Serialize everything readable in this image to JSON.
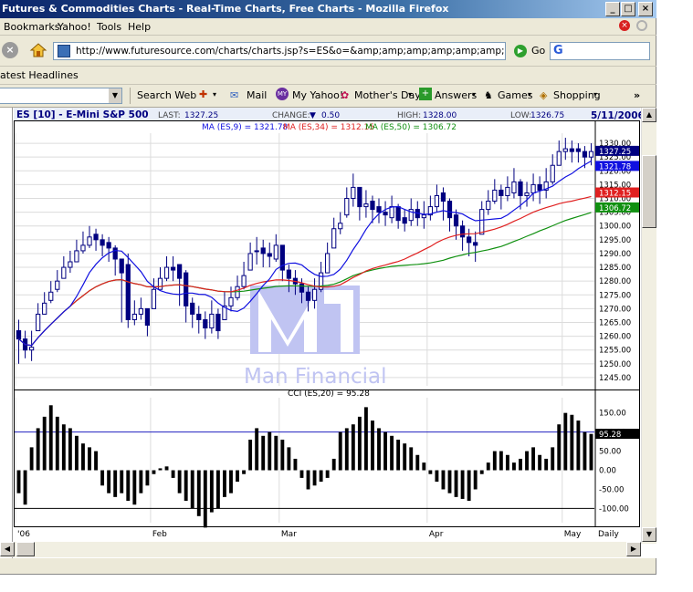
{
  "window": {
    "title": "Futures & Commodities Charts - Real-Time Charts, Free Charts - Mozilla Firefox"
  },
  "menu": [
    "Bookmarks",
    "Yahoo!",
    "Tools",
    "Help"
  ],
  "nav": {
    "url": "http://www.futuresource.com/charts/charts.jsp?s=ES&o=&amp;amp;amp;amp;amp;amp;amp;amp;amp;a=D&",
    "go_label": "Go",
    "search_logo": "G"
  },
  "bookmarks": {
    "headlines_label": "atest Headlines"
  },
  "yahoo_toolbar": {
    "items": [
      "Search Web",
      "Mail",
      "My Yahoo!",
      "Mother's Day",
      "Answers",
      "Games",
      "Shopping"
    ],
    "overflow": "»"
  },
  "chart_header": {
    "symbol": "ES [10] - E-Mini S&P 500",
    "last_label": "LAST:",
    "last_value": "1327.25",
    "change_label": "CHANGE:",
    "change_value": "0.50",
    "high_label": "HIGH:",
    "high_value": "1328.00",
    "low_label": "LOW:",
    "low_value": "1326.75",
    "date": "5/11/2006",
    "ma9_label": "MA (ES,9) = 1321.78",
    "ma34_label": "MA (ES,34) = 1312.15",
    "ma50_label": "MA (ES,50) = 1306.72",
    "cci_label": "CCI (ES,20) = 95.28",
    "watermark": "Man Financial",
    "period_label": "Daily",
    "colors": {
      "ma9": "#1010e0",
      "ma34": "#e02020",
      "ma50": "#109010",
      "candles": "#000080",
      "header_text": "#000080",
      "watermark": "#c0c4f2"
    }
  },
  "chart_data": [
    {
      "type": "candlestick",
      "title": "ES [10] - E-Mini S&P 500",
      "period": "Daily",
      "ylim": [
        1242,
        1333
      ],
      "y_ticks": [
        "1330.00",
        "1325.00",
        "1320.00",
        "1315.00",
        "1310.00",
        "1305.00",
        "1300.00",
        "1295.00",
        "1290.00",
        "1285.00",
        "1280.00",
        "1275.00",
        "1270.00",
        "1265.00",
        "1260.00",
        "1255.00",
        "1250.00",
        "1245.00"
      ],
      "y_tick_values": [
        1330,
        1325,
        1320,
        1315,
        1310,
        1305,
        1300,
        1295,
        1290,
        1285,
        1280,
        1275,
        1270,
        1265,
        1260,
        1255,
        1250,
        1245
      ],
      "x_ticks": [
        "'06",
        "Feb",
        "Mar",
        "Apr",
        "May"
      ],
      "x_tick_index": [
        0,
        21,
        41,
        64,
        85
      ],
      "price_tags": [
        {
          "label": "1327.25",
          "value": 1327.25,
          "color": "#000080"
        },
        {
          "label": "1321.78",
          "value": 1321.78,
          "color": "#1010e0"
        },
        {
          "label": "1312.15",
          "value": 1312.15,
          "color": "#e02020"
        },
        {
          "label": "1306.72",
          "value": 1306.72,
          "color": "#109010"
        }
      ],
      "series": [
        {
          "name": "ES",
          "close": [
            1259,
            1255,
            1256,
            1268,
            1272,
            1276,
            1280,
            1285,
            1287,
            1291,
            1293,
            1296,
            1295,
            1293,
            1292,
            1288,
            1283,
            1266,
            1268,
            1270,
            1264,
            1277,
            1281,
            1285,
            1284,
            1281,
            1271,
            1268,
            1266,
            1263,
            1268,
            1262,
            1271,
            1274,
            1278,
            1282,
            1290,
            1291,
            1290,
            1289,
            1293,
            1284,
            1281,
            1279,
            1276,
            1273,
            1277,
            1283,
            1290,
            1299,
            1301,
            1310,
            1314,
            1307,
            1308,
            1306,
            1305,
            1304,
            1307,
            1302,
            1301,
            1306,
            1303,
            1304,
            1307,
            1311,
            1309,
            1303,
            1300,
            1296,
            1294,
            1293,
            1306,
            1309,
            1313,
            1311,
            1314,
            1316,
            1311,
            1312,
            1315,
            1313,
            1316,
            1322,
            1327,
            1328,
            1327,
            1327,
            1325,
            1327
          ],
          "high": [
            1266,
            1262,
            1262,
            1272,
            1276,
            1280,
            1284,
            1289,
            1291,
            1295,
            1298,
            1300,
            1299,
            1297,
            1296,
            1293,
            1288,
            1290,
            1273,
            1274,
            1270,
            1281,
            1285,
            1289,
            1289,
            1286,
            1284,
            1274,
            1271,
            1269,
            1273,
            1270,
            1276,
            1278,
            1282,
            1287,
            1294,
            1296,
            1295,
            1294,
            1297,
            1292,
            1286,
            1284,
            1281,
            1278,
            1281,
            1287,
            1294,
            1303,
            1305,
            1314,
            1319,
            1313,
            1313,
            1311,
            1310,
            1309,
            1311,
            1308,
            1306,
            1310,
            1309,
            1309,
            1311,
            1315,
            1314,
            1310,
            1306,
            1302,
            1299,
            1298,
            1309,
            1313,
            1317,
            1315,
            1318,
            1321,
            1317,
            1316,
            1319,
            1318,
            1321,
            1326,
            1331,
            1332,
            1331,
            1330,
            1329,
            1330
          ],
          "low": [
            1250,
            1252,
            1251,
            1262,
            1268,
            1272,
            1276,
            1281,
            1283,
            1287,
            1290,
            1292,
            1291,
            1289,
            1287,
            1282,
            1265,
            1263,
            1264,
            1266,
            1260,
            1270,
            1277,
            1280,
            1280,
            1271,
            1265,
            1263,
            1261,
            1259,
            1261,
            1259,
            1266,
            1269,
            1273,
            1277,
            1284,
            1286,
            1285,
            1285,
            1287,
            1280,
            1276,
            1275,
            1272,
            1269,
            1270,
            1276,
            1283,
            1292,
            1297,
            1303,
            1307,
            1302,
            1303,
            1301,
            1301,
            1300,
            1301,
            1299,
            1298,
            1300,
            1300,
            1299,
            1302,
            1305,
            1302,
            1298,
            1295,
            1291,
            1289,
            1287,
            1297,
            1304,
            1308,
            1306,
            1309,
            1310,
            1306,
            1307,
            1309,
            1308,
            1310,
            1315,
            1322,
            1324,
            1323,
            1323,
            1321,
            1322
          ],
          "open": [
            1262,
            1259,
            1255,
            1262,
            1268,
            1273,
            1277,
            1281,
            1285,
            1287,
            1291,
            1293,
            1297,
            1295,
            1294,
            1292,
            1288,
            1286,
            1266,
            1268,
            1270,
            1270,
            1277,
            1281,
            1285,
            1286,
            1283,
            1272,
            1268,
            1266,
            1263,
            1268,
            1266,
            1271,
            1274,
            1278,
            1284,
            1291,
            1292,
            1290,
            1288,
            1293,
            1284,
            1281,
            1279,
            1276,
            1273,
            1277,
            1283,
            1292,
            1299,
            1304,
            1310,
            1314,
            1307,
            1309,
            1307,
            1305,
            1303,
            1307,
            1303,
            1302,
            1306,
            1303,
            1304,
            1307,
            1312,
            1309,
            1304,
            1300,
            1296,
            1294,
            1297,
            1306,
            1309,
            1313,
            1311,
            1312,
            1316,
            1311,
            1312,
            1315,
            1313,
            1316,
            1322,
            1327,
            1328,
            1328,
            1327,
            1325
          ]
        }
      ]
    },
    {
      "type": "bar",
      "title": "CCI (ES,20) = 95.28",
      "ylim": [
        -130,
        185
      ],
      "y_ticks": [
        "150.00",
        "100.00",
        "50.00",
        "0.00",
        "-50.00",
        "-100.00"
      ],
      "y_tick_values": [
        150,
        100,
        50,
        0,
        -50,
        -100
      ],
      "reference_lines": [
        100,
        -100
      ],
      "current_label": "95.28",
      "current_value": 95.28,
      "values": [
        -60,
        -90,
        60,
        110,
        140,
        170,
        140,
        120,
        110,
        90,
        70,
        60,
        50,
        -40,
        -60,
        -70,
        -60,
        -80,
        -90,
        -60,
        -40,
        -10,
        5,
        10,
        -20,
        -60,
        -80,
        -100,
        -120,
        -150,
        -110,
        -100,
        -70,
        -60,
        -30,
        -10,
        80,
        110,
        90,
        100,
        90,
        80,
        60,
        30,
        -20,
        -50,
        -40,
        -30,
        -20,
        30,
        100,
        110,
        120,
        140,
        165,
        130,
        110,
        100,
        90,
        80,
        70,
        60,
        40,
        20,
        -10,
        -30,
        -50,
        -60,
        -70,
        -75,
        -80,
        -50,
        -10,
        20,
        50,
        50,
        40,
        20,
        30,
        50,
        60,
        40,
        30,
        60,
        120,
        150,
        145,
        130,
        100,
        95
      ],
      "x_ticks": [
        "'06",
        "Feb",
        "Mar",
        "Apr",
        "May"
      ]
    }
  ]
}
